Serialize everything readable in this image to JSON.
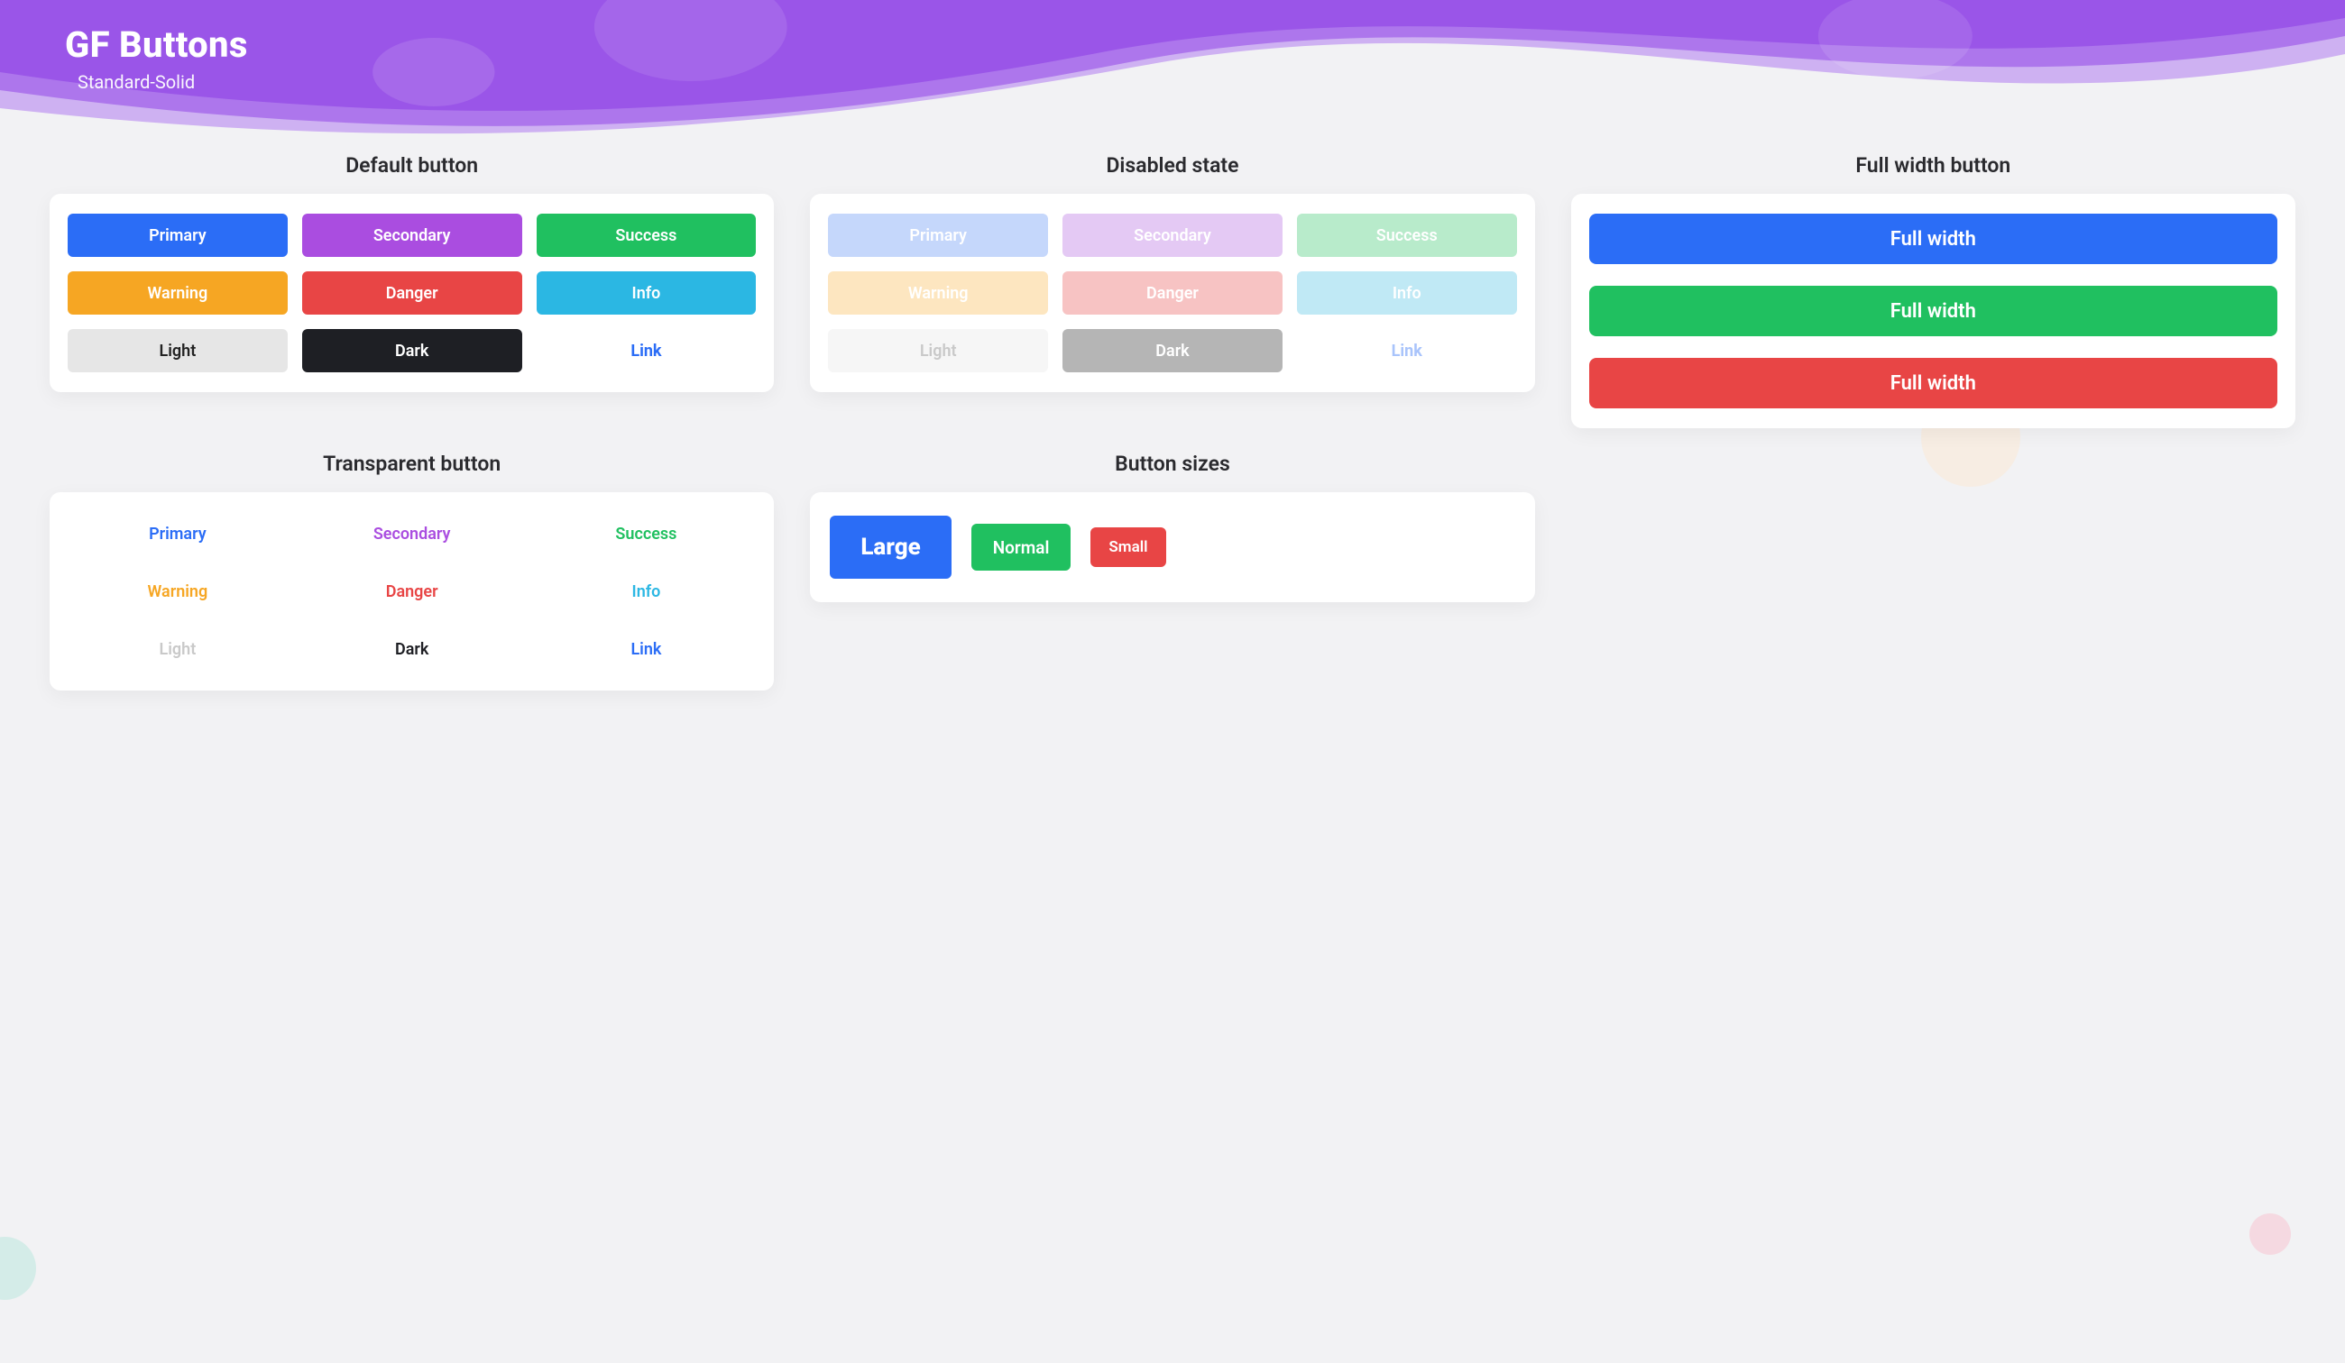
{
  "hero": {
    "title": "GF Buttons",
    "subtitle": "Standard-Solid"
  },
  "colors": {
    "primary": "#2b6df6",
    "secondary": "#aa4de0",
    "success": "#20c060",
    "warning": "#f6a623",
    "danger": "#e84545",
    "info": "#2bb7e3",
    "light": "#e6e6e6",
    "dark": "#1e1f24",
    "link": "#2b6df6",
    "primary_d": "#c5d7fb",
    "secondary_d": "#e4c9f4",
    "success_d": "#b8ebcb",
    "warning_d": "#fde6c0",
    "danger_d": "#f7c3c3",
    "info_d": "#c0e9f5",
    "light_d": "#f6f6f6",
    "dark_d": "#b5b5b5",
    "link_d": "#a9c4fb"
  },
  "sections": {
    "default": {
      "title": "Default button"
    },
    "disabled": {
      "title": "Disabled  state"
    },
    "fullwidth": {
      "title": "Full width button"
    },
    "transparent": {
      "title": "Transparent button"
    },
    "sizes": {
      "title": "Button sizes"
    }
  },
  "labels": {
    "primary": "Primary",
    "secondary": "Secondary",
    "success": "Success",
    "warning": "Warning",
    "danger": "Danger",
    "info": "Info",
    "light": "Light",
    "dark": "Dark",
    "link": "Link",
    "fullwidth": "Full width",
    "large": "Large",
    "normal": "Normal",
    "small": "Small"
  }
}
